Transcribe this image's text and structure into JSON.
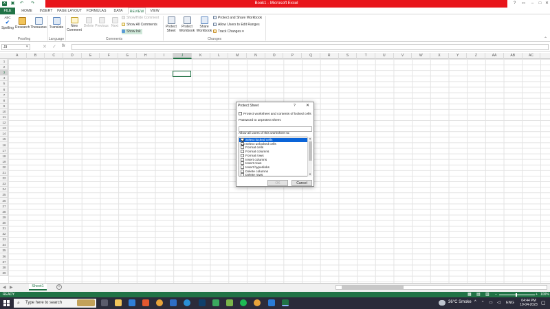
{
  "window": {
    "title": "Book1 - Microsoft Excel"
  },
  "tabs": [
    "FILE",
    "HOME",
    "INSERT",
    "PAGE LAYOUT",
    "FORMULAS",
    "DATA",
    "REVIEW",
    "VIEW"
  ],
  "ribbon": {
    "proofing": {
      "spelling": "Spelling",
      "research": "Research",
      "thesaurus": "Thesaurus",
      "spelling_abc": "ABC",
      "label": "Proofing"
    },
    "language": {
      "translate": "Translate",
      "label": "Language"
    },
    "comments": {
      "new_comment_1": "New",
      "new_comment_2": "Comment",
      "delete": "Delete",
      "previous": "Previous",
      "next": "Next",
      "show_hide": "Show/Hide Comment",
      "show_all": "Show All Comments",
      "show_ink": "Show Ink",
      "label": "Comments"
    },
    "changes": {
      "protect_sheet_1": "Protect",
      "protect_sheet_2": "Sheet",
      "protect_workbook_1": "Protect",
      "protect_workbook_2": "Workbook",
      "share_workbook_1": "Share",
      "share_workbook_2": "Workbook",
      "protect_share": "Protect and Share Workbook",
      "allow_ranges": "Allow Users to Edit Ranges",
      "track_changes": "Track Changes ▾",
      "label": "Changes"
    }
  },
  "formula_bar": {
    "name_box": "J3",
    "fx": "fx"
  },
  "columns": [
    "A",
    "B",
    "C",
    "D",
    "E",
    "F",
    "G",
    "H",
    "I",
    "J",
    "K",
    "L",
    "M",
    "N",
    "O",
    "P",
    "Q",
    "R",
    "S",
    "T",
    "U",
    "V",
    "W",
    "X",
    "Y",
    "Z",
    "AA",
    "AB",
    "AC"
  ],
  "rows": [
    "1",
    "2",
    "3",
    "4",
    "5",
    "6",
    "7",
    "8",
    "9",
    "10",
    "11",
    "12",
    "13",
    "14",
    "15",
    "16",
    "17",
    "18",
    "19",
    "20",
    "21",
    "22",
    "23",
    "24",
    "25",
    "26",
    "27",
    "28",
    "29",
    "30",
    "31",
    "32",
    "33",
    "34",
    "35",
    "36",
    "37",
    "38",
    "39"
  ],
  "sheet_tabs": {
    "active": "Sheet1",
    "add": "+"
  },
  "status": {
    "ready": "READY",
    "zoom": "100%"
  },
  "dialog": {
    "title": "Protect Sheet",
    "help": "?",
    "close": "✕",
    "protect_label": "Protect worksheet and contents of locked cells",
    "password_label": "Password to unprotect sheet:",
    "allow_label": "Allow all users of this worksheet to:",
    "options": [
      {
        "label": "Select locked cells",
        "checked": true
      },
      {
        "label": "Select unlocked cells",
        "checked": true
      },
      {
        "label": "Format cells",
        "checked": false
      },
      {
        "label": "Format columns",
        "checked": false
      },
      {
        "label": "Format rows",
        "checked": false
      },
      {
        "label": "Insert columns",
        "checked": false
      },
      {
        "label": "Insert rows",
        "checked": false
      },
      {
        "label": "Insert hyperlinks",
        "checked": false
      },
      {
        "label": "Delete columns",
        "checked": false
      },
      {
        "label": "Delete rows",
        "checked": false
      }
    ],
    "ok": "OK",
    "cancel": "Cancel"
  },
  "taskbar": {
    "search": "Type here to search",
    "weather": "36°C Smoke",
    "lang": "ENG",
    "time": "04:44 PM",
    "date": "19-04-2023"
  }
}
